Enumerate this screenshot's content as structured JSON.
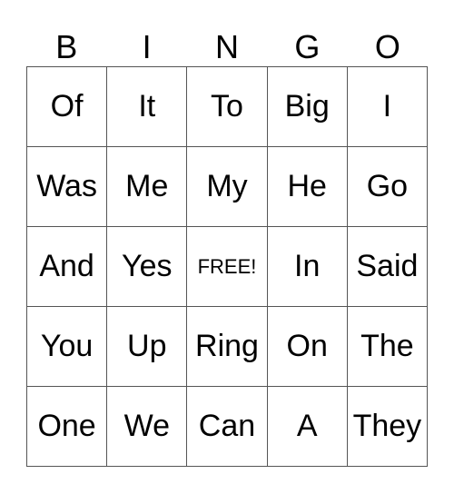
{
  "header": [
    "B",
    "I",
    "N",
    "G",
    "O"
  ],
  "rows": [
    [
      "Of",
      "It",
      "To",
      "Big",
      "I"
    ],
    [
      "Was",
      "Me",
      "My",
      "He",
      "Go"
    ],
    [
      "And",
      "Yes",
      "FREE!",
      "In",
      "Said"
    ],
    [
      "You",
      "Up",
      "Ring",
      "On",
      "The"
    ],
    [
      "One",
      "We",
      "Can",
      "A",
      "They"
    ]
  ]
}
